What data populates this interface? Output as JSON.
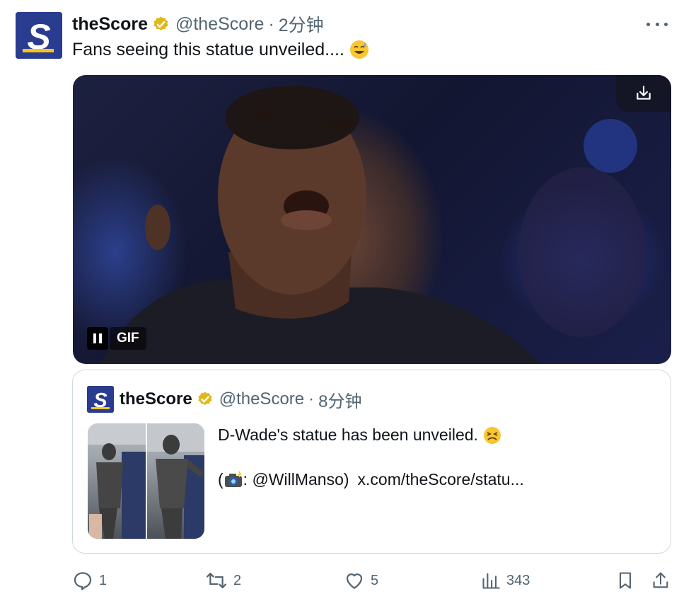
{
  "tweet": {
    "name": "theScore",
    "handle": "@theScore",
    "separator": "·",
    "time": "2分钟",
    "text": "Fans seeing this statue unveiled....",
    "emoji": "sweat-smile-emoji",
    "more_icon": "more-dots-icon"
  },
  "media": {
    "gif_label": "GIF",
    "pause_icon": "pause-icon",
    "download_icon": "download-icon"
  },
  "quote": {
    "name": "theScore",
    "handle": "@theScore",
    "separator": "·",
    "time": "8分钟",
    "line1": "D-Wade's statue has been unveiled.",
    "line1_emoji": "persevering-face-emoji",
    "line2_open": "(",
    "line2_camera": "camera-flash-emoji",
    "line2_credit": ": @WillManso)",
    "line2_link": "x.com/theScore/statu..."
  },
  "actions": {
    "reply_count": "1",
    "retweet_count": "2",
    "like_count": "5",
    "views_count": "343"
  },
  "colors": {
    "brand_blue": "#2a3c8f",
    "brand_yellow": "#f5c518",
    "verified_gold": "#e2b719",
    "secondary_text": "#536471",
    "border": "#cfd9de"
  }
}
